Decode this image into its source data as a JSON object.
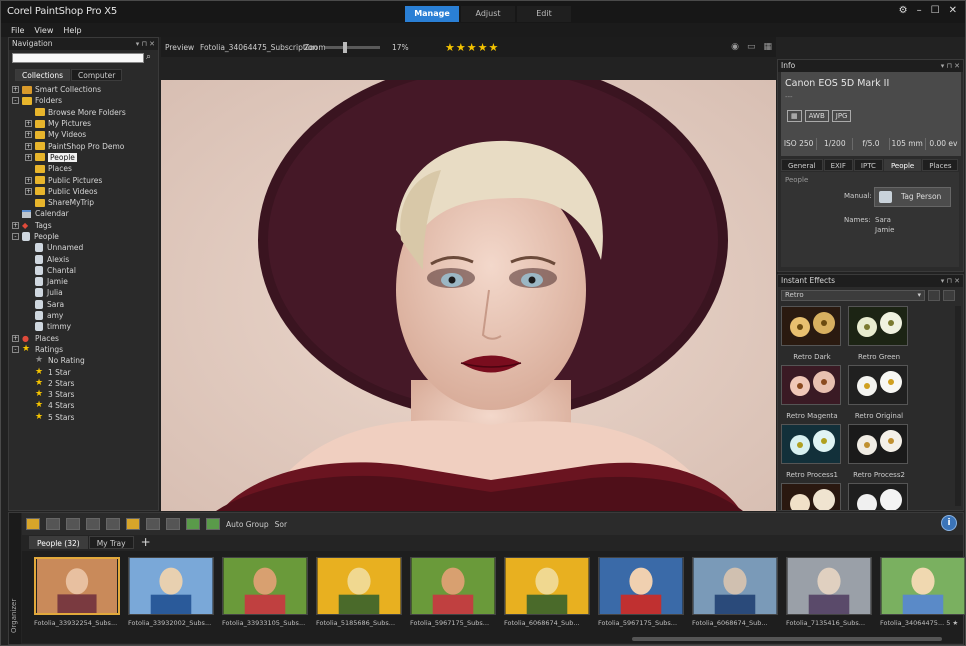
{
  "app": {
    "title": "Corel PaintShop Pro X5",
    "tabs": [
      {
        "label": "Manage",
        "active": true
      },
      {
        "label": "Adjust",
        "active": false
      },
      {
        "label": "Edit",
        "active": false
      }
    ],
    "accent_color": "#2a7fd5"
  },
  "menu": [
    "File",
    "View",
    "Help"
  ],
  "navigation": {
    "title": "Navigation",
    "search_placeholder": "",
    "tabs": [
      "Collections",
      "Computer"
    ],
    "tree": [
      {
        "label": "Smart Collections",
        "icon": "smart-collection-icon",
        "exp": "+",
        "level": 0
      },
      {
        "label": "Folders",
        "icon": "folder-icon",
        "exp": "-",
        "level": 0
      },
      {
        "label": "Browse More Folders",
        "icon": "folder-icon",
        "exp": "",
        "level": 1
      },
      {
        "label": "My Pictures",
        "icon": "folder-icon",
        "exp": "+",
        "level": 1
      },
      {
        "label": "My Videos",
        "icon": "folder-icon",
        "exp": "+",
        "level": 1
      },
      {
        "label": "PaintShop Pro Demo",
        "icon": "folder-icon",
        "exp": "+",
        "level": 1
      },
      {
        "label": "People",
        "icon": "folder-icon",
        "exp": "+",
        "level": 1,
        "selected": true
      },
      {
        "label": "Places",
        "icon": "folder-icon",
        "exp": "",
        "level": 1
      },
      {
        "label": "Public Pictures",
        "icon": "folder-icon",
        "exp": "+",
        "level": 1
      },
      {
        "label": "Public Videos",
        "icon": "folder-icon",
        "exp": "+",
        "level": 1
      },
      {
        "label": "ShareMyTrip",
        "icon": "folder-icon",
        "exp": "",
        "level": 1
      },
      {
        "label": "Calendar",
        "icon": "calendar-icon",
        "exp": "",
        "level": 0
      },
      {
        "label": "Tags",
        "icon": "tag-icon",
        "exp": "+",
        "level": 0
      },
      {
        "label": "People",
        "icon": "person-icon",
        "exp": "-",
        "level": 0
      },
      {
        "label": "Unnamed",
        "icon": "person-icon",
        "exp": "",
        "level": 1
      },
      {
        "label": "Alexis",
        "icon": "person-icon",
        "exp": "",
        "level": 1
      },
      {
        "label": "Chantal",
        "icon": "person-icon",
        "exp": "",
        "level": 1
      },
      {
        "label": "Jamie",
        "icon": "person-icon",
        "exp": "",
        "level": 1
      },
      {
        "label": "Julia",
        "icon": "person-icon",
        "exp": "",
        "level": 1
      },
      {
        "label": "Sara",
        "icon": "person-icon",
        "exp": "",
        "level": 1
      },
      {
        "label": "amy",
        "icon": "person-icon",
        "exp": "",
        "level": 1
      },
      {
        "label": "timmy",
        "icon": "person-icon",
        "exp": "",
        "level": 1
      },
      {
        "label": "Places",
        "icon": "pin-icon",
        "exp": "+",
        "level": 0
      },
      {
        "label": "Ratings",
        "icon": "star-icon",
        "exp": "-",
        "level": 0
      },
      {
        "label": "No Rating",
        "icon": "star-grey-icon",
        "exp": "",
        "level": 1
      },
      {
        "label": "1 Star",
        "icon": "star-icon",
        "exp": "",
        "level": 1
      },
      {
        "label": "2 Stars",
        "icon": "star-icon",
        "exp": "",
        "level": 1
      },
      {
        "label": "3 Stars",
        "icon": "star-icon",
        "exp": "",
        "level": 1
      },
      {
        "label": "4 Stars",
        "icon": "star-icon",
        "exp": "",
        "level": 1
      },
      {
        "label": "5 Stars",
        "icon": "star-icon",
        "exp": "",
        "level": 1
      }
    ]
  },
  "preview": {
    "label": "Preview",
    "filename": "Fotolia_34064475_Subscription",
    "zoom_label": "Zoom",
    "zoom_value": "17%",
    "rating_stars": "★★★★★",
    "rating": 5
  },
  "info": {
    "title": "Info",
    "camera": "Canon EOS 5D Mark II",
    "camera_sub": "---",
    "badges": [
      "AWB",
      "JPG"
    ],
    "values": [
      "ISO 250",
      "1/200",
      "f/5.0",
      "105 mm",
      "0.00 ev"
    ],
    "tabs": [
      {
        "label": "General",
        "active": false
      },
      {
        "label": "EXIF",
        "active": false
      },
      {
        "label": "IPTC",
        "active": false
      },
      {
        "label": "People",
        "active": true
      },
      {
        "label": "Places",
        "active": false
      }
    ],
    "section": "People",
    "manual_label": "Manual:",
    "tag_button": "Tag Person",
    "names_label": "Names:",
    "names": [
      "Sara",
      "Jamie"
    ]
  },
  "effects": {
    "title": "Instant Effects",
    "category": "Retro",
    "items": [
      "Retro Dark",
      "Retro Green",
      "Retro Magenta",
      "Retro Original",
      "Retro Process1",
      "Retro Process2"
    ]
  },
  "organizer": {
    "side_label": "Organizer",
    "toolbar_auto_group": "Auto Group",
    "toolbar_sort": "Sor",
    "info_glyph": "i",
    "tabs": [
      {
        "label": "People (32)",
        "active": true
      },
      {
        "label": "My Tray",
        "active": false
      }
    ],
    "add_tab": "+",
    "thumbnails": [
      {
        "caption": "Fotolia_33932254_Subs...",
        "selected": true
      },
      {
        "caption": "Fotolia_33932002_Subs..."
      },
      {
        "caption": "Fotolia_33933105_Subs..."
      },
      {
        "caption": "Fotolia_5185686_Subs..."
      },
      {
        "caption": "Fotolia_5967175_Subs..."
      },
      {
        "caption": "Fotolia_6068674_Sub..."
      },
      {
        "caption": "Fotolia_5967175_Subs..."
      },
      {
        "caption": "Fotolia_6068674_Sub..."
      },
      {
        "caption": "Fotolia_7135416_Subs..."
      },
      {
        "caption": "Fotolia_34064475...  5 ★"
      }
    ]
  }
}
